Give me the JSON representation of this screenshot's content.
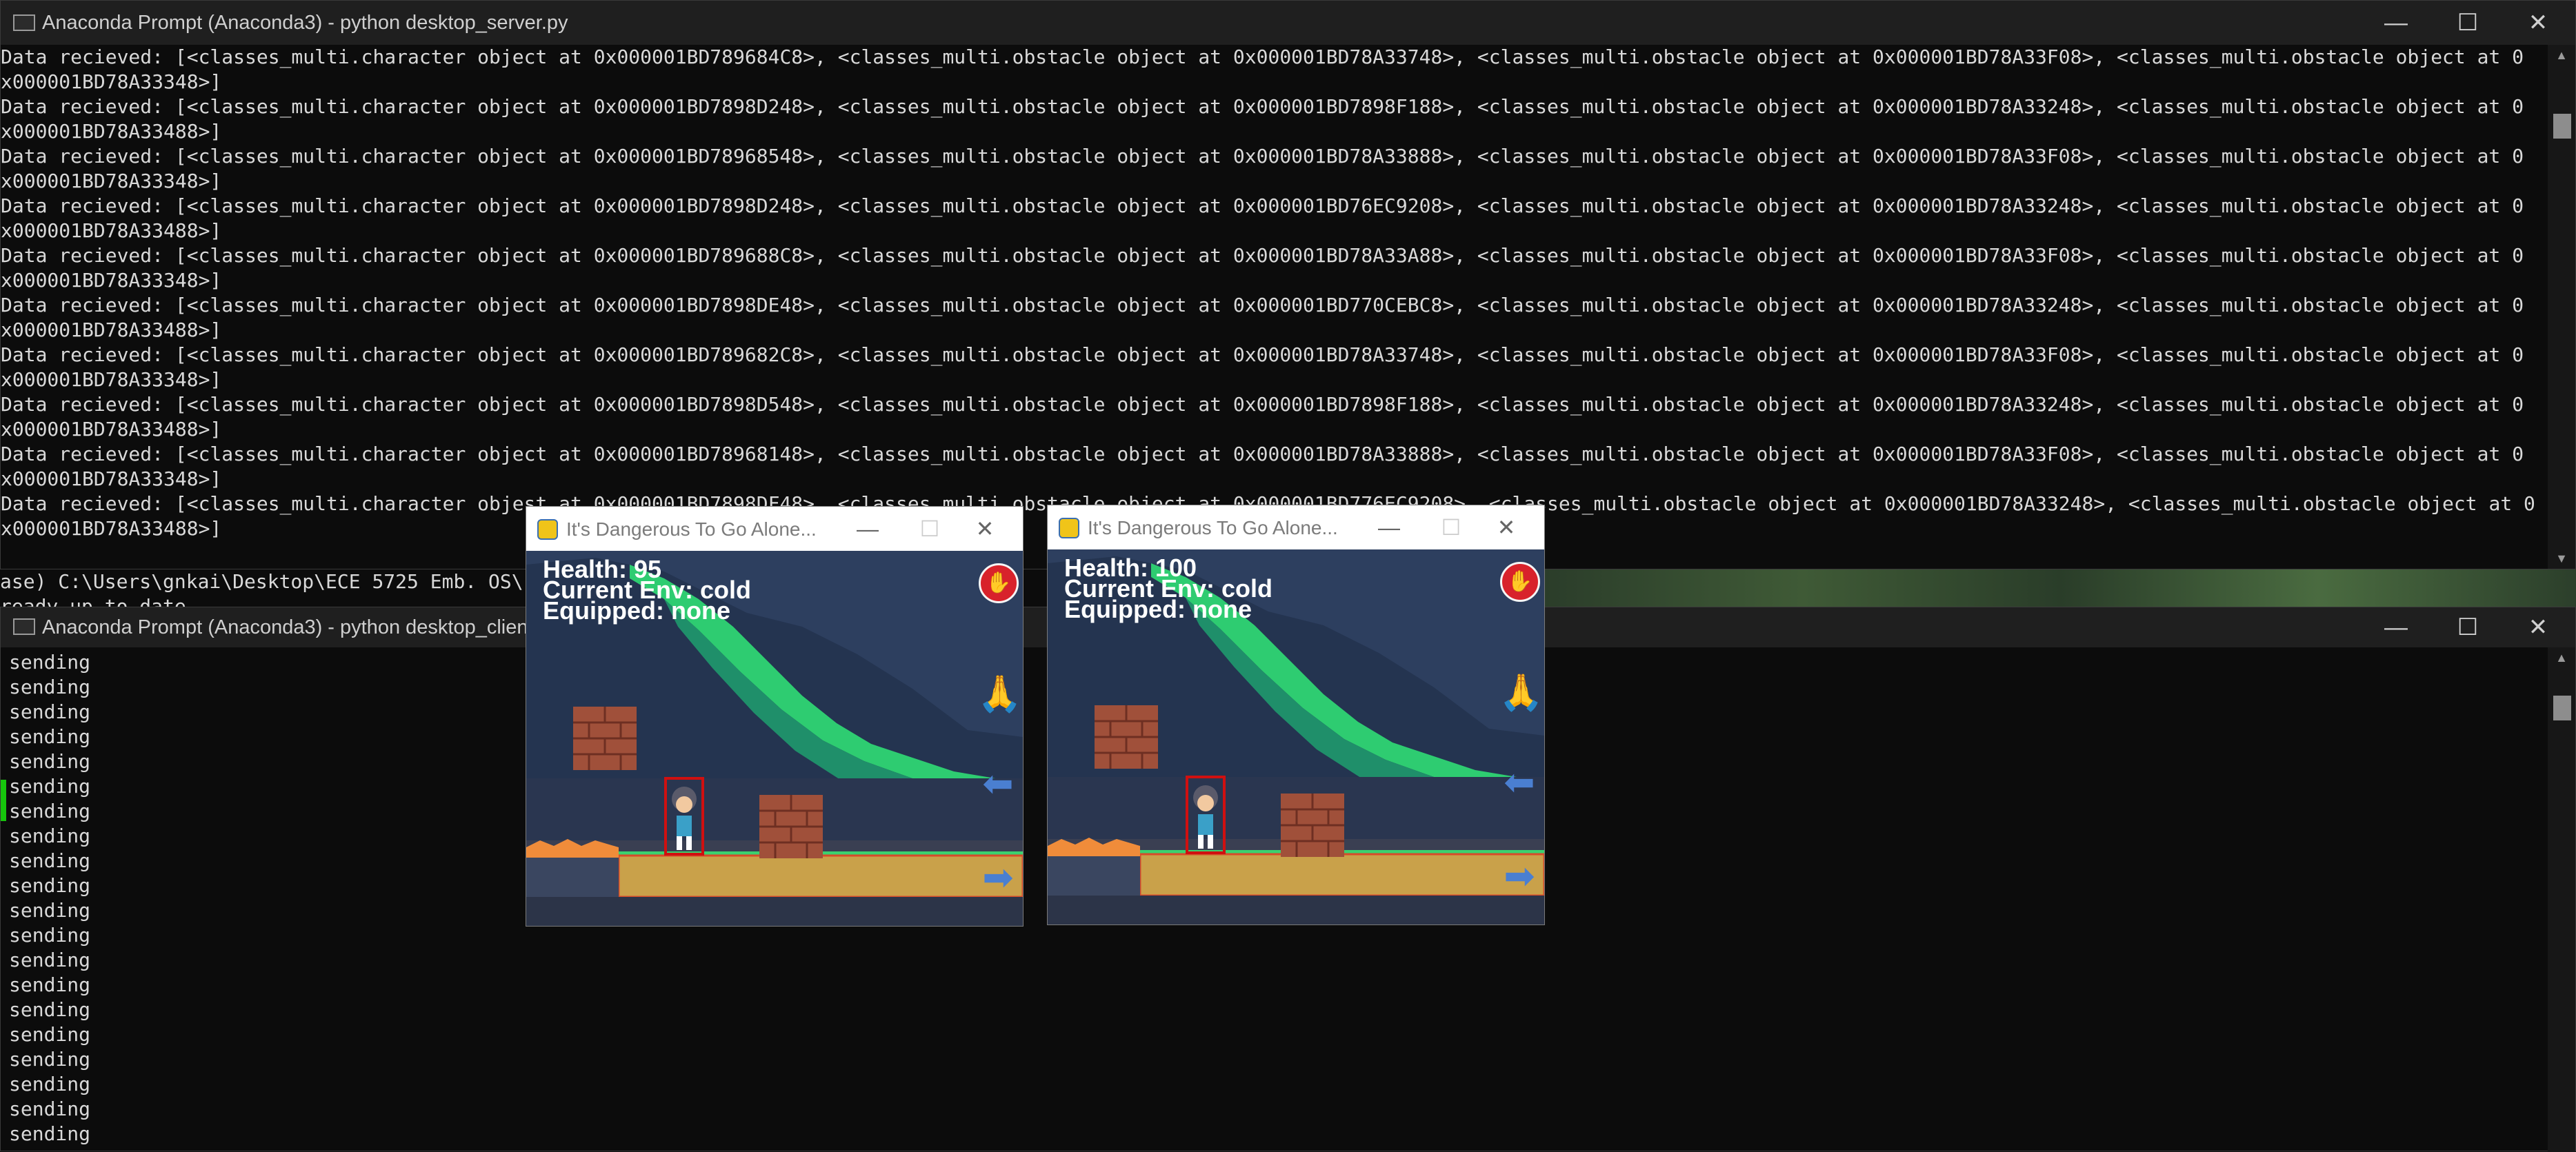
{
  "server_window": {
    "title": "Anaconda Prompt (Anaconda3) - python  desktop_server.py",
    "lines": [
      "Data recieved: [<classes_multi.character object at 0x000001BD789684C8>, <classes_multi.obstacle object at 0x000001BD78A33748>, <classes_multi.obstacle object at 0x000001BD78A33F08>, <classes_multi.obstacle object at 0",
      "x000001BD78A33348>]",
      "Data recieved: [<classes_multi.character object at 0x000001BD7898D248>, <classes_multi.obstacle object at 0x000001BD7898F188>, <classes_multi.obstacle object at 0x000001BD78A33248>, <classes_multi.obstacle object at 0",
      "x000001BD78A33488>]",
      "Data recieved: [<classes_multi.character object at 0x000001BD78968548>, <classes_multi.obstacle object at 0x000001BD78A33888>, <classes_multi.obstacle object at 0x000001BD78A33F08>, <classes_multi.obstacle object at 0",
      "x000001BD78A33348>]",
      "Data recieved: [<classes_multi.character object at 0x000001BD7898D248>, <classes_multi.obstacle object at 0x000001BD76EC9208>, <classes_multi.obstacle object at 0x000001BD78A33248>, <classes_multi.obstacle object at 0",
      "x000001BD78A33488>]",
      "Data recieved: [<classes_multi.character object at 0x000001BD789688C8>, <classes_multi.obstacle object at 0x000001BD78A33A88>, <classes_multi.obstacle object at 0x000001BD78A33F08>, <classes_multi.obstacle object at 0",
      "x000001BD78A33348>]",
      "Data recieved: [<classes_multi.character object at 0x000001BD7898DE48>, <classes_multi.obstacle object at 0x000001BD770CEBC8>, <classes_multi.obstacle object at 0x000001BD78A33248>, <classes_multi.obstacle object at 0",
      "x000001BD78A33488>]",
      "Data recieved: [<classes_multi.character object at 0x000001BD789682C8>, <classes_multi.obstacle object at 0x000001BD78A33748>, <classes_multi.obstacle object at 0x000001BD78A33F08>, <classes_multi.obstacle object at 0",
      "x000001BD78A33348>]",
      "Data recieved: [<classes_multi.character object at 0x000001BD7898D548>, <classes_multi.obstacle object at 0x000001BD7898F188>, <classes_multi.obstacle object at 0x000001BD78A33248>, <classes_multi.obstacle object at 0",
      "x000001BD78A33488>]",
      "Data recieved: [<classes_multi.character object at 0x000001BD78968148>, <classes_multi.obstacle object at 0x000001BD78A33888>, <classes_multi.obstacle object at 0x000001BD78A33F08>, <classes_multi.obstacle object at 0",
      "x000001BD78A33348>]",
      "Data recieved: [<classes_multi.character objest at 0x000001BD7898DF48>, <classes_multi.obstacle object at 0x000001BD776EC9208>, <classes_multi.obstacle object at 0x000001BD78A33248>, <classes_multi.obstacle object at 0",
      "x000001BD78A33488>]"
    ],
    "below_lines": [
      "ase) C:\\Users\\gnkai\\Desktop\\ECE 5725 Emb. OS\\",
      "ready up to date."
    ]
  },
  "client_window": {
    "title": "Anaconda Prompt (Anaconda3) - python  desktop_client.py",
    "line": "sending",
    "line_count": 20
  },
  "game_windows": [
    {
      "title": "It's Dangerous To Go Alone...",
      "health": "Health: 95",
      "env": "Current Env: cold",
      "equipped": "Equipped: none"
    },
    {
      "title": "It's Dangerous To Go Alone...",
      "health": "Health: 100",
      "env": "Current Env: cold",
      "equipped": "Equipped: none"
    }
  ],
  "window_controls": {
    "minimize": "—",
    "maximize": "☐",
    "close": "✕"
  },
  "colors": {
    "console_bg": "#0c0c0c",
    "console_text": "#d9d9d9",
    "titlebar": "#1f1f1f",
    "ground": "#c9a14a",
    "grass": "#3bd16f",
    "brick": "#a0503a"
  }
}
